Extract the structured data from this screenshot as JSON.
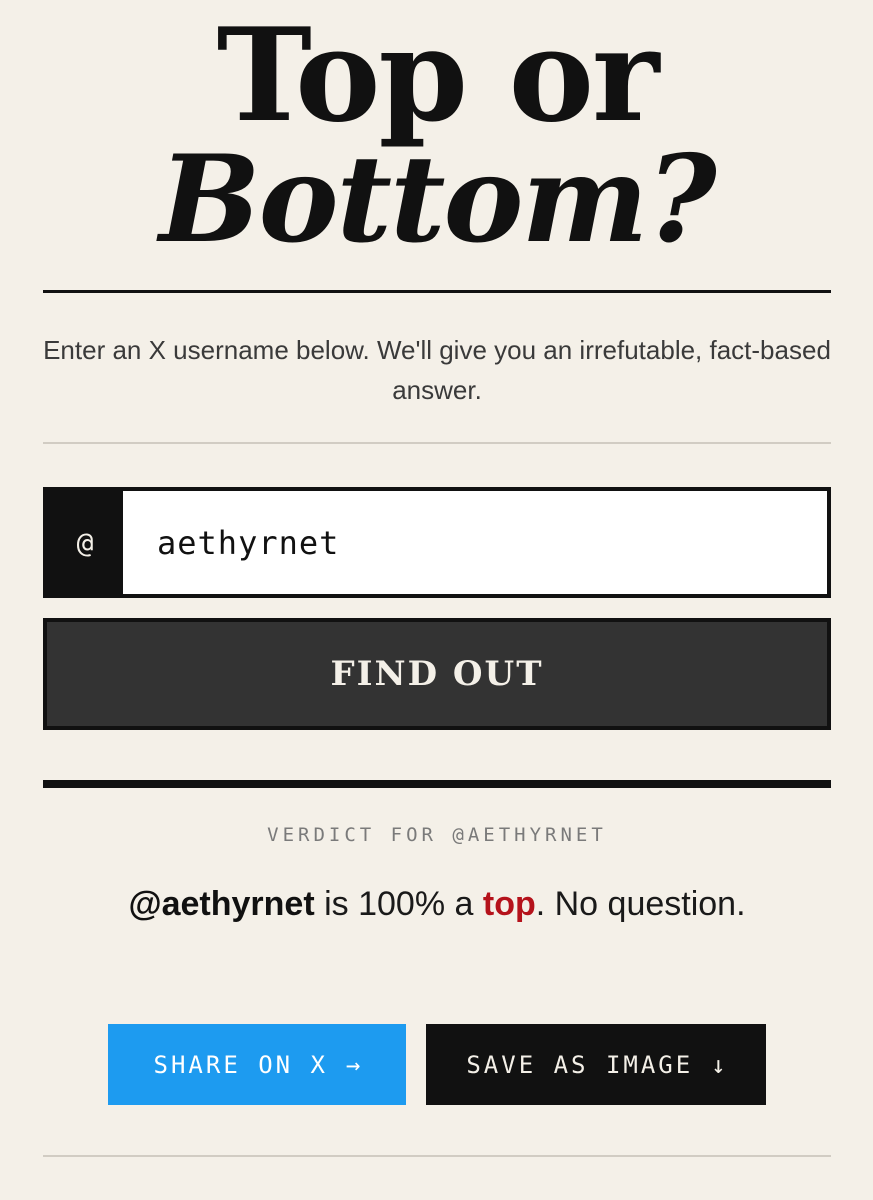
{
  "header": {
    "title_line1": "Top or",
    "title_line2": "Bottom?"
  },
  "intro": {
    "text": "Enter an X username below. We'll give you an irrefutable, fact-based answer."
  },
  "form": {
    "at_symbol": "@",
    "username_value": "aethyrnet",
    "submit_label": "FIND OUT"
  },
  "result": {
    "label": "VERDICT FOR @AETHYRNET",
    "handle": "@aethyrnet",
    "middle": " is 100% a ",
    "verdict_word": "top",
    "ending": ". No question."
  },
  "actions": {
    "share_label": "SHARE ON X",
    "share_icon": "→",
    "save_label": "SAVE AS IMAGE",
    "save_icon": "↓"
  },
  "colors": {
    "background": "#f4f0e8",
    "ink": "#111111",
    "accent_red": "#b5121b",
    "share_blue": "#1d9bf0"
  }
}
